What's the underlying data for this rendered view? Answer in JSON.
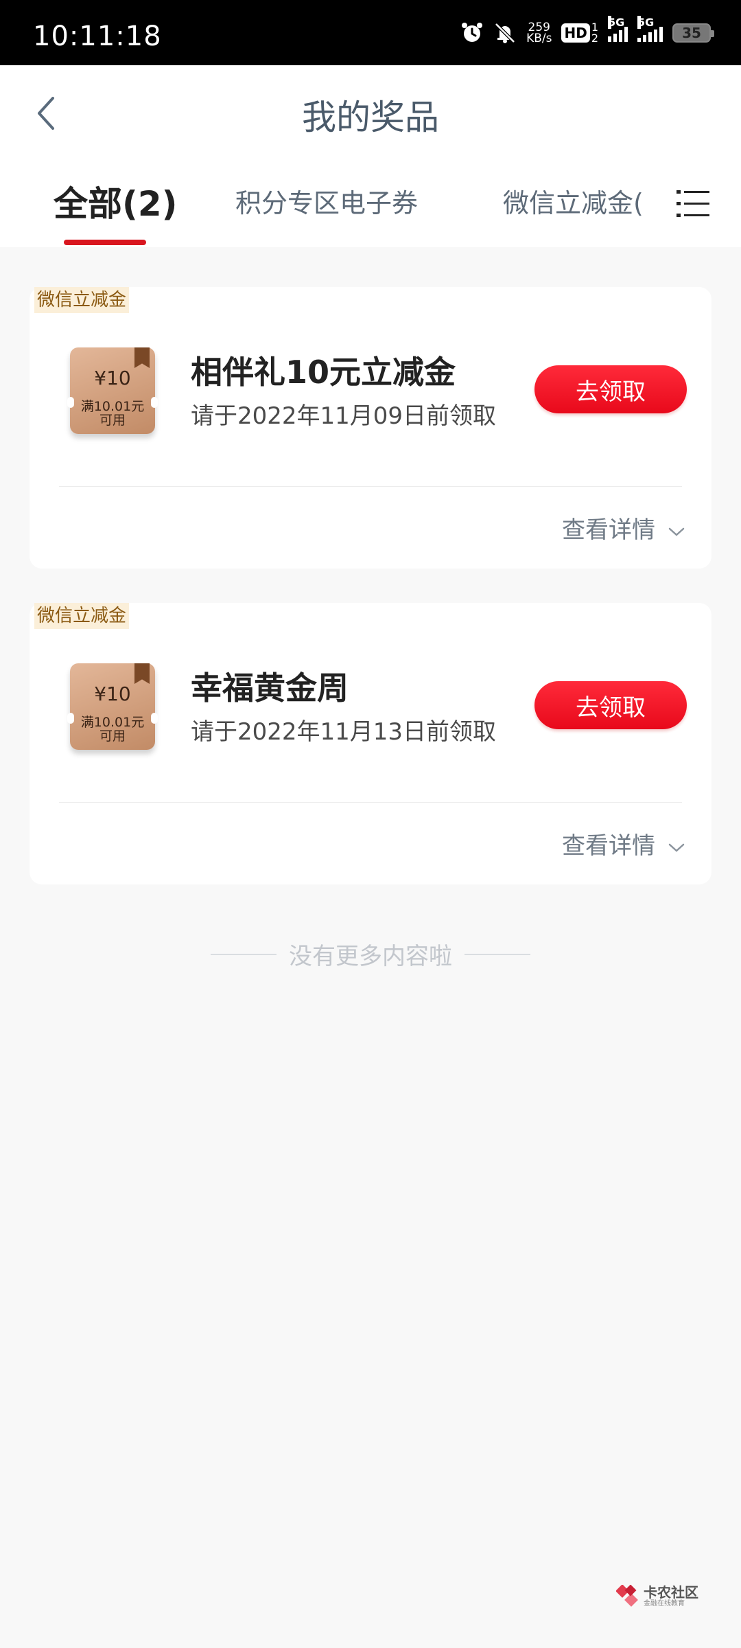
{
  "status_bar": {
    "time": "10:11:18",
    "net_speed_value": "259",
    "net_speed_unit": "KB/s",
    "hd_label": "HD",
    "hd_sub_top": "1",
    "hd_sub_bottom": "2",
    "signal1_label": "5G",
    "signal2_label": "5G",
    "battery": "35"
  },
  "header": {
    "title": "我的奖品"
  },
  "tabs": [
    {
      "label": "全部(2)",
      "active": true
    },
    {
      "label": "积分专区电子券",
      "active": false
    },
    {
      "label": "微信立减金(",
      "active": false
    }
  ],
  "prizes": [
    {
      "tag": "微信立减金",
      "coupon_amount": "¥10",
      "coupon_condition_line1": "满10.01元",
      "coupon_condition_line2": "可用",
      "name": "相伴礼10元立减金",
      "deadline": "请于2022年11月09日前领取",
      "claim_label": "去领取",
      "details_label": "查看详情"
    },
    {
      "tag": "微信立减金",
      "coupon_amount": "¥10",
      "coupon_condition_line1": "满10.01元",
      "coupon_condition_line2": "可用",
      "name": "幸福黄金周",
      "deadline": "请于2022年11月13日前领取",
      "claim_label": "去领取",
      "details_label": "查看详情"
    }
  ],
  "footer": {
    "no_more": "没有更多内容啦"
  },
  "watermark": {
    "title": "卡农社区",
    "subtitle": "金融在线教育"
  },
  "colors": {
    "accent_red": "#d9161f",
    "tag_bg": "#fbefd9",
    "tag_text": "#8b5a12"
  }
}
